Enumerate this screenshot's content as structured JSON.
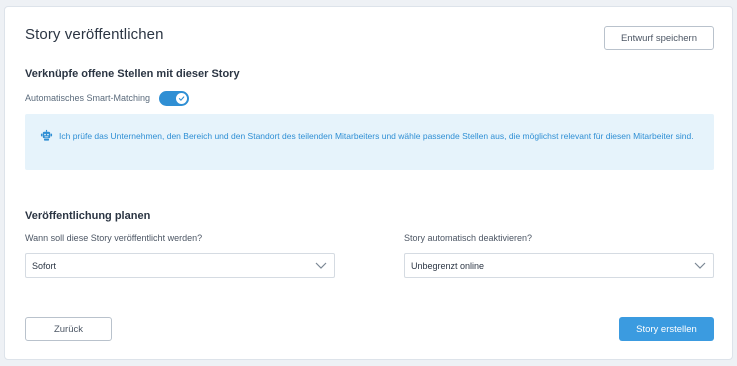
{
  "page": {
    "title": "Story veröffentlichen",
    "draft_button": "Entwurf speichern"
  },
  "linking": {
    "heading": "Verknüpfe offene Stellen mit dieser Story",
    "smart_matching_label": "Automatisches Smart-Matching",
    "smart_matching_enabled": true,
    "info_text": "Ich prüfe das Unternehmen, den Bereich und den Standort des teilenden Mitarbeiters und wähle passende Stellen aus, die möglichst relevant für diesen Mitarbeiter sind.",
    "info_icon": "robot-icon"
  },
  "schedule": {
    "heading": "Veröffentlichung planen",
    "publish_label": "Wann soll diese Story veröffentlicht werden?",
    "publish_value": "Sofort",
    "deactivate_label": "Story automatisch deaktivieren?",
    "deactivate_value": "Unbegrenzt online"
  },
  "footer": {
    "back_button": "Zurück",
    "create_button": "Story erstellen"
  },
  "colors": {
    "accent": "#3b9be0",
    "info_background": "#e6f3fb",
    "page_background": "#eef1f5"
  }
}
